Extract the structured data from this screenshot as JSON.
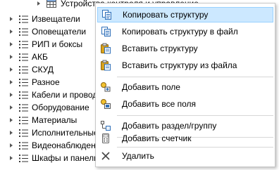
{
  "tree": {
    "top_item": {
      "label": "Устройства контроля и управление",
      "icon": "table-icon"
    },
    "items": [
      {
        "label": "Извещатели",
        "icon": "list-icon"
      },
      {
        "label": "Оповещатели",
        "icon": "list-icon"
      },
      {
        "label": "РИП и боксы",
        "icon": "list-icon"
      },
      {
        "label": "АКБ",
        "icon": "list-icon"
      },
      {
        "label": "СКУД",
        "icon": "list-icon"
      },
      {
        "label": "Разное",
        "icon": "list-icon"
      },
      {
        "label": "Кабели и провода",
        "icon": "list-icon"
      },
      {
        "label": "Оборудование",
        "icon": "list-icon"
      },
      {
        "label": "Материалы",
        "icon": "list-icon"
      },
      {
        "label": "Исполнительные",
        "icon": "list-icon"
      },
      {
        "label": "Видеонаблюдение",
        "icon": "list-icon"
      },
      {
        "label": "Шкафы и панели",
        "icon": "list-icon"
      }
    ]
  },
  "context_menu": {
    "items": [
      {
        "label": "Копировать структуру",
        "icon": "copy-structure-icon",
        "selected": true
      },
      {
        "label": "Копировать структуру в файл",
        "icon": "copy-to-file-icon"
      },
      {
        "label": "Вставить структуру",
        "icon": "paste-structure-icon"
      },
      {
        "label": "Вставить структуру из файла",
        "icon": "paste-from-file-icon"
      },
      {
        "label": "Добавить поле",
        "icon": "add-field-icon"
      },
      {
        "label": "Добавить все поля",
        "icon": "add-all-fields-icon"
      },
      {
        "label": "Добавить раздел/группу",
        "icon": "add-section-icon"
      },
      {
        "label": "Добавить счетчик",
        "icon": "counter-icon"
      },
      {
        "label": "Удалить",
        "icon": "delete-icon"
      }
    ]
  },
  "colors": {
    "selection_bg": "#cce8ff",
    "selection_border": "#99d1ff",
    "icon_blue": "#2f6fb8",
    "icon_gold": "#d9a21b"
  }
}
